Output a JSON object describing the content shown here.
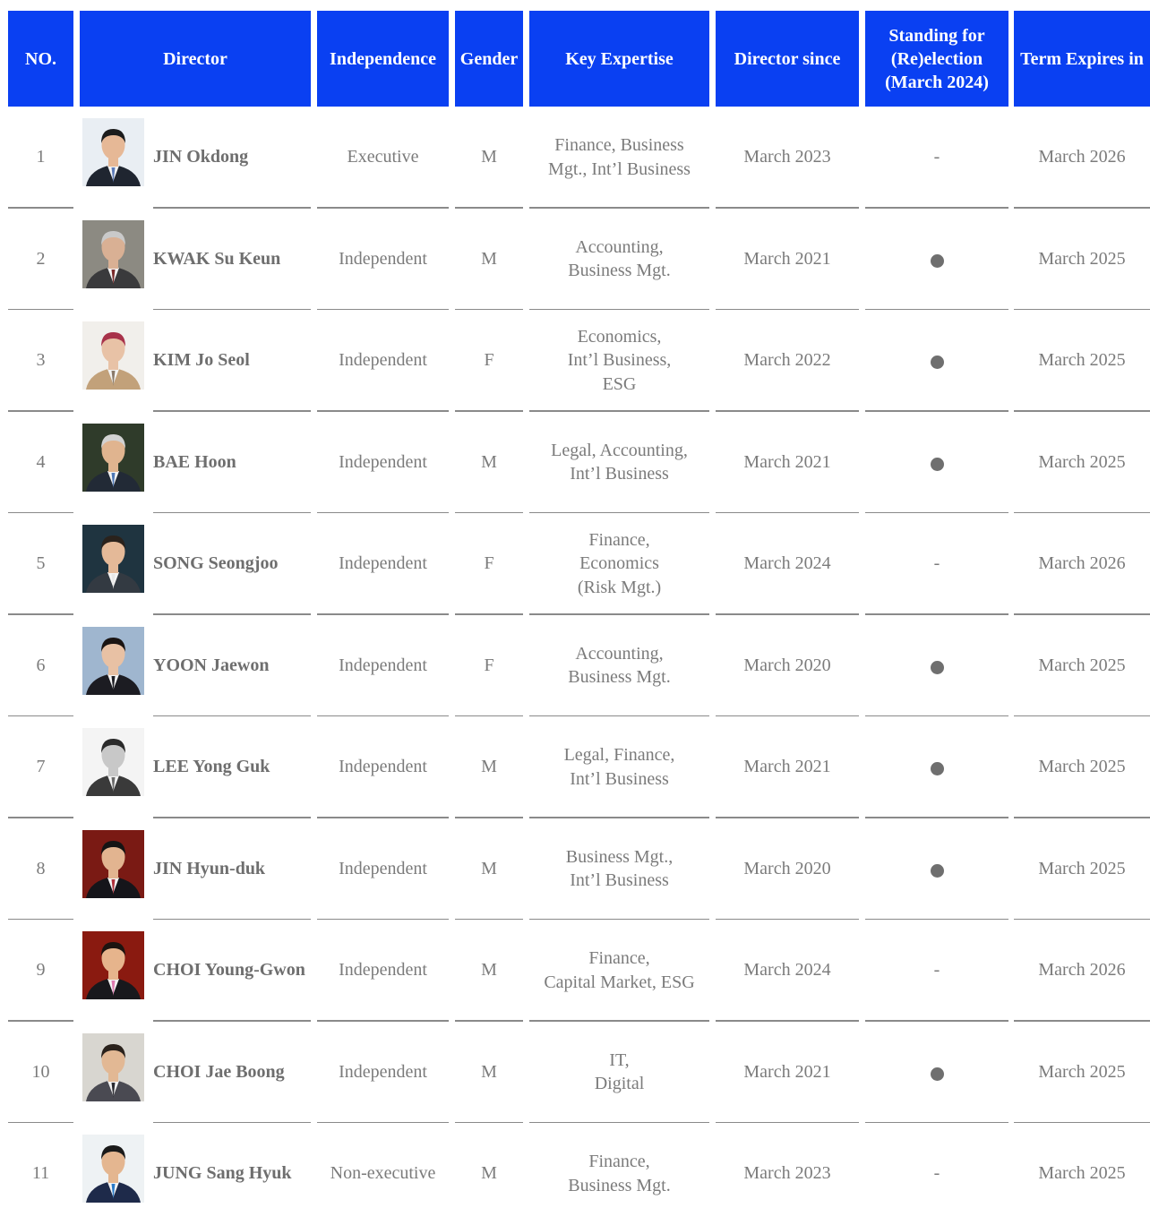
{
  "headers": {
    "no": "NO.",
    "director": "Director",
    "independence": "Independence",
    "gender": "Gender",
    "expertise": "Key Expertise",
    "since": "Director since",
    "standing": "Standing for\n(Re)election\n(March 2024)",
    "term": "Term Expires in"
  },
  "rows": [
    {
      "no": "1",
      "name": "JIN Okdong",
      "independence": "Executive",
      "gender": "M",
      "expertise": "Finance, Business\nMgt., Int’l Business",
      "since": "March 2023",
      "standing": "-",
      "term": "March 2026",
      "photo": {
        "bg": "#e9eef3",
        "skin": "#e6b896",
        "hair": "#1c1c1c",
        "suit": "#1f2530",
        "tie": "#5b7ab8"
      }
    },
    {
      "no": "2",
      "name": "KWAK Su Keun",
      "independence": "Independent",
      "gender": "M",
      "expertise": "Accounting,\nBusiness Mgt.",
      "since": "March 2021",
      "standing": "●",
      "term": "March 2025",
      "photo": {
        "bg": "#8c8a82",
        "skin": "#d9b094",
        "hair": "#c9c9c9",
        "suit": "#3a3a3c",
        "tie": "#7a2a2a"
      }
    },
    {
      "no": "3",
      "name": "KIM Jo Seol",
      "independence": "Independent",
      "gender": "F",
      "expertise": "Economics,\nInt’l Business,\nESG",
      "since": "March 2022",
      "standing": "●",
      "term": "March 2025",
      "photo": {
        "bg": "#f1efeb",
        "skin": "#e8c2a6",
        "hair": "#a8324a",
        "suit": "#c2a17a",
        "tie": "#8a7a6a"
      }
    },
    {
      "no": "4",
      "name": "BAE Hoon",
      "independence": "Independent",
      "gender": "M",
      "expertise": "Legal, Accounting,\nInt’l Business",
      "since": "March 2021",
      "standing": "●",
      "term": "March 2025",
      "photo": {
        "bg": "#2f3b2a",
        "skin": "#e0b48f",
        "hair": "#d2d2d2",
        "suit": "#222a36",
        "tie": "#4f78b6"
      }
    },
    {
      "no": "5",
      "name": "SONG Seongjoo",
      "independence": "Independent",
      "gender": "F",
      "expertise": "Finance,\nEconomics\n(Risk Mgt.)",
      "since": "March 2024",
      "standing": "-",
      "term": "March 2026",
      "photo": {
        "bg": "#1f3440",
        "skin": "#e4b998",
        "hair": "#2a221c",
        "suit": "#333a42",
        "tie": "#e8e8e8"
      }
    },
    {
      "no": "6",
      "name": "YOON Jaewon",
      "independence": "Independent",
      "gender": "F",
      "expertise": "Accounting,\nBusiness Mgt.",
      "since": "March 2020",
      "standing": "●",
      "term": "March 2025",
      "photo": {
        "bg": "#9fb6cf",
        "skin": "#e8c1a4",
        "hair": "#1a1412",
        "suit": "#1c1c22",
        "tie": "#1c1c22"
      }
    },
    {
      "no": "7",
      "name": "LEE Yong Guk",
      "independence": "Independent",
      "gender": "M",
      "expertise": "Legal, Finance,\nInt’l Business",
      "since": "March 2021",
      "standing": "●",
      "term": "March 2025",
      "photo": {
        "bg": "#f4f4f4",
        "skin": "#c8c8c8",
        "hair": "#2a2a2a",
        "suit": "#3a3a3a",
        "tie": "#6a6a6a"
      }
    },
    {
      "no": "8",
      "name": "JIN Hyun-duk",
      "independence": "Independent",
      "gender": "M",
      "expertise": "Business Mgt.,\nInt’l Business",
      "since": "March 2020",
      "standing": "●",
      "term": "March 2025",
      "photo": {
        "bg": "#7a1a14",
        "skin": "#e2b490",
        "hair": "#141414",
        "suit": "#15151a",
        "tie": "#b0303a"
      }
    },
    {
      "no": "9",
      "name": "CHOI Young-Gwon",
      "independence": "Independent",
      "gender": "M",
      "expertise": "Finance,\nCapital Market, ESG",
      "since": "March 2024",
      "standing": "-",
      "term": "March 2026",
      "photo": {
        "bg": "#8a1a10",
        "skin": "#e6b48c",
        "hair": "#1c1410",
        "suit": "#18181c",
        "tie": "#e07ab0"
      }
    },
    {
      "no": "10",
      "name": "CHOI Jae Boong",
      "independence": "Independent",
      "gender": "M",
      "expertise": "IT,\nDigital",
      "since": "March 2021",
      "standing": "●",
      "term": "March 2025",
      "photo": {
        "bg": "#d8d6d0",
        "skin": "#e2b894",
        "hair": "#2a221c",
        "suit": "#4a4a52",
        "tie": "#2a2a30"
      }
    },
    {
      "no": "11",
      "name": "JUNG Sang Hyuk",
      "independence": "Non-executive",
      "gender": "M",
      "expertise": "Finance,\nBusiness Mgt.",
      "since": "March 2023",
      "standing": "-",
      "term": "March 2025",
      "photo": {
        "bg": "#eef2f4",
        "skin": "#e4b690",
        "hair": "#1a1a1a",
        "suit": "#1e2a4a",
        "tie": "#2a7ac8"
      }
    }
  ]
}
